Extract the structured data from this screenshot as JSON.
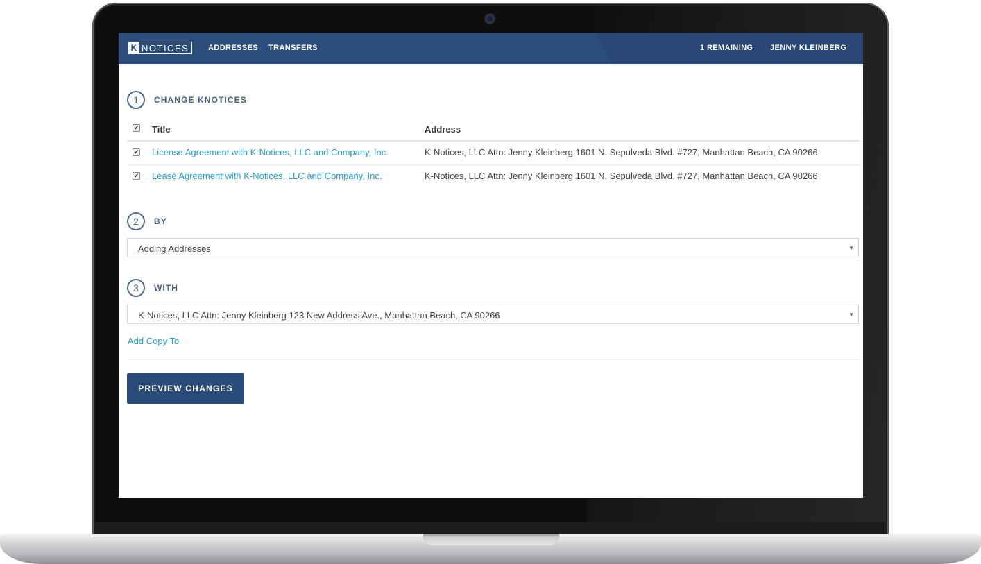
{
  "header": {
    "logo_k": "K",
    "logo_text": "NOTICES",
    "nav": {
      "addresses": "ADDRESSES",
      "transfers": "TRANSFERS"
    },
    "remaining": "1 REMAINING",
    "user": "JENNY KLEINBERG"
  },
  "steps": [
    {
      "number": "1",
      "label": "CHANGE KNOTICES"
    },
    {
      "number": "2",
      "label": "BY"
    },
    {
      "number": "3",
      "label": "WITH"
    }
  ],
  "table": {
    "headers": {
      "title": "Title",
      "address": "Address"
    },
    "select_all_checked": true,
    "rows": [
      {
        "checked": true,
        "title": "License Agreement with K-Notices, LLC and Company, Inc.",
        "address": "K-Notices, LLC Attn: Jenny Kleinberg 1601 N. Sepulveda Blvd. #727, Manhattan Beach, CA 90266"
      },
      {
        "checked": true,
        "title": "Lease Agreement with K-Notices, LLC and Company, Inc.",
        "address": "K-Notices, LLC Attn: Jenny Kleinberg 1601 N. Sepulveda Blvd. #727, Manhattan Beach, CA 90266"
      }
    ]
  },
  "by_select": {
    "value": "Adding Addresses"
  },
  "with_select": {
    "value": "K-Notices, LLC Attn: Jenny Kleinberg 123 New Address Ave., Manhattan Beach, CA 90266"
  },
  "add_copy_label": "Add Copy To",
  "preview_label": "PREVIEW CHANGES",
  "colors": {
    "navy": "#2a4a78",
    "link": "#1fa0d6",
    "step": "#4f6a8f"
  }
}
